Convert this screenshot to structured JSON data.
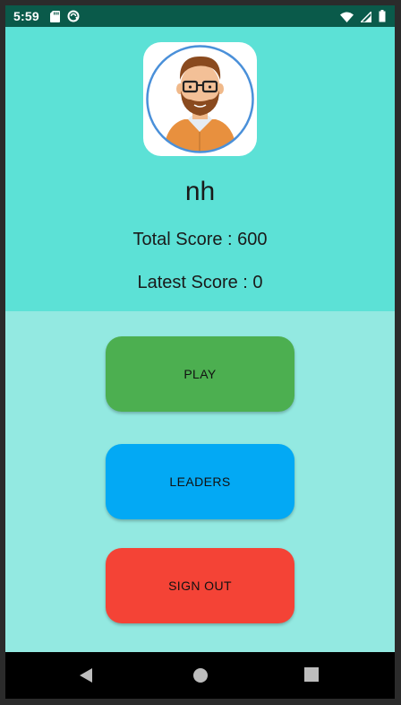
{
  "status_bar": {
    "time": "5:59",
    "left_icons": [
      "sd-card-icon",
      "sync-icon"
    ],
    "right_icons": [
      "wifi-icon",
      "cellular-signal-icon",
      "battery-icon"
    ]
  },
  "profile": {
    "avatar": "avatar-icon",
    "username": "nh",
    "total_score": "Total Score : 600",
    "latest_score": "Latest Score : 0"
  },
  "actions": {
    "play_label": "PLAY",
    "leaders_label": "LEADERS",
    "sign_out_label": "SIGN OUT"
  },
  "nav_bar": {
    "icons": [
      "back-icon",
      "home-icon",
      "recents-icon"
    ]
  },
  "colors": {
    "status_bar": "#0a5a4a",
    "header_bg": "#5ce1d6",
    "content_bg": "#93e9e1",
    "play": "#4caf50",
    "leaders": "#03a9f4",
    "sign_out": "#f44336"
  }
}
